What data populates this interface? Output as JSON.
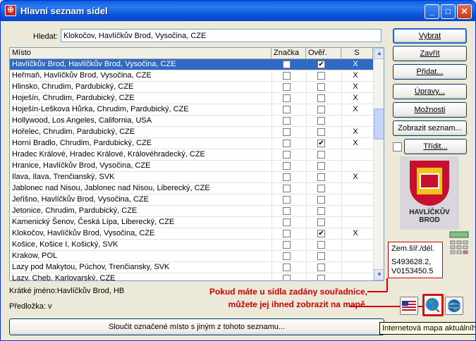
{
  "window": {
    "title": "Hlavní seznam sídel",
    "controls": {
      "minimize": "_",
      "maximize": "□",
      "close": "✕"
    }
  },
  "search": {
    "label": "Hledat:",
    "value": "Klokočov, Havlíčkův Brod, Vysočina, CZE"
  },
  "grid": {
    "columns": {
      "name": "Místo",
      "znacka": "Značka",
      "over": "Ověř.",
      "s": "S"
    },
    "rows": [
      {
        "name": "Havlíčkův Brod, Havlíčkův Brod, Vysočina, CZE",
        "znacka": false,
        "over": true,
        "s": "X",
        "selected": true
      },
      {
        "name": "Heřmaň, Havlíčkův Brod, Vysočina, CZE",
        "znacka": false,
        "over": false,
        "s": "X",
        "selected": false
      },
      {
        "name": "Hlinsko, Chrudim, Pardubický, CZE",
        "znacka": false,
        "over": false,
        "s": "X",
        "selected": false
      },
      {
        "name": "Hoješín, Chrudim, Pardubický, CZE",
        "znacka": false,
        "over": false,
        "s": "X",
        "selected": false
      },
      {
        "name": "Hoješín-Leškova Hůrka, Chrudim, Pardubický, CZE",
        "znacka": false,
        "over": false,
        "s": "X",
        "selected": false
      },
      {
        "name": "Hollywood, Los Angeles, California, USA",
        "znacka": false,
        "over": false,
        "s": "",
        "selected": false
      },
      {
        "name": "Hořelec, Chrudim, Pardubický, CZE",
        "znacka": false,
        "over": false,
        "s": "X",
        "selected": false
      },
      {
        "name": "Horní Bradlo, Chrudim, Pardubický, CZE",
        "znacka": false,
        "over": true,
        "s": "X",
        "selected": false
      },
      {
        "name": "Hradec Králové, Hradec Králové, Královéhradecký, CZE",
        "znacka": false,
        "over": false,
        "s": "",
        "selected": false
      },
      {
        "name": "Hranice, Havlíčkův Brod, Vysočina, CZE",
        "znacka": false,
        "over": false,
        "s": "",
        "selected": false
      },
      {
        "name": "Ilava, Ilava, Trenčianský, SVK",
        "znacka": false,
        "over": false,
        "s": "X",
        "selected": false
      },
      {
        "name": "Jablonec nad Nisou, Jablonec nad Nisou, Liberecký, CZE",
        "znacka": false,
        "over": false,
        "s": "",
        "selected": false
      },
      {
        "name": "Jeřišno, Havlíčkův Brod, Vysočina, CZE",
        "znacka": false,
        "over": false,
        "s": "",
        "selected": false
      },
      {
        "name": "Jetonice, Chrudim, Pardubický, CZE",
        "znacka": false,
        "over": false,
        "s": "",
        "selected": false
      },
      {
        "name": "Kamenický Šenov, Česká Lípa, Liberecký, CZE",
        "znacka": false,
        "over": false,
        "s": "",
        "selected": false
      },
      {
        "name": "Klokočov, Havlíčkův Brod, Vysočina, CZE",
        "znacka": false,
        "over": true,
        "s": "X",
        "selected": false
      },
      {
        "name": "Košice, Košice I, Košický, SVK",
        "znacka": false,
        "over": false,
        "s": "",
        "selected": false
      },
      {
        "name": "Krakow, POL",
        "znacka": false,
        "over": false,
        "s": "",
        "selected": false
      },
      {
        "name": "Lazy pod Makytou, Púchov, Trenčiansky, SVK",
        "znacka": false,
        "over": false,
        "s": "",
        "selected": false
      },
      {
        "name": "Lazy, Cheb, Karlovarský, CZE",
        "znacka": false,
        "over": false,
        "s": "",
        "selected": false
      }
    ]
  },
  "buttons": {
    "vybrat": "Vybrat",
    "zavrit": "Zavřít",
    "pridat": "Přidat...",
    "upravy": "Úpravy...",
    "moznosti": "Možnosti",
    "zobrazit": "Zobrazit seznam...",
    "tridit": "Třídit..."
  },
  "coat_of_arms": {
    "text": "HAVLÍČKŮV BROD"
  },
  "coords": {
    "label": "Zem.šíř./dél.",
    "lat": "S493628.2,",
    "lon": "V0153450.5"
  },
  "footer": {
    "short_name": "Krátké jméno:Havlíčkův Brod, HB",
    "predloha": "Předložka: v",
    "merge_button": "Sloučit označené místo s jiným z tohoto seznamu..."
  },
  "callout": {
    "line1": "Pokud máte u sídla zadány souřadnice,",
    "line2": "můžete jej ihned zobrazit na mapě."
  },
  "tooltip": "Internetová mapa aktuálního",
  "icons": {
    "flag": "us-flag-icon",
    "map": "globe-map-icon",
    "net": "internet-globe-icon",
    "calc": "calculator-icon",
    "app": "app-icon"
  },
  "colors": {
    "selection": "#316ac5",
    "callout": "#cc0000",
    "titlebar": "#0a5ddf"
  }
}
